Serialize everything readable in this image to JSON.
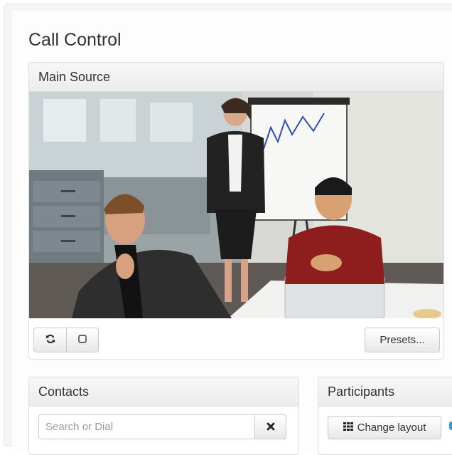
{
  "page": {
    "title": "Call Control"
  },
  "main_source": {
    "heading": "Main Source",
    "presets_label": "Presets..."
  },
  "contacts": {
    "heading": "Contacts",
    "search_placeholder": "Search or Dial"
  },
  "participants": {
    "heading": "Participants",
    "change_layout_label": "Change layout"
  },
  "icons": {
    "refresh": "refresh-icon",
    "square": "square-icon",
    "close": "close-icon",
    "grid": "grid-icon"
  }
}
